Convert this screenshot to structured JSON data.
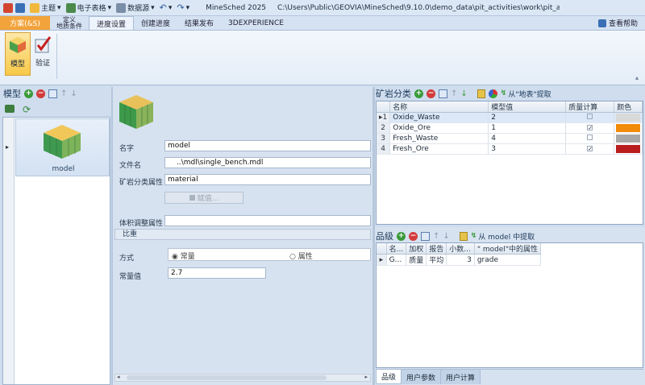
{
  "titlebar": {
    "menu1": "主题",
    "menu2": "电子表格",
    "menu3": "数据源",
    "app_name": "MineSched 2025",
    "path": "C:\\Users\\Public\\GEOVIA\\MineSched\\9.10.0\\demo_data\\pit_activities\\work\\pit_activities...."
  },
  "tabs": {
    "file": "方案(&S)",
    "define_line1": "定义",
    "define_line2": "地质条件",
    "schedule": "进度设置",
    "create": "创建进度",
    "results": "结果发布",
    "experience": "3DEXPERIENCE",
    "help": "查看帮助"
  },
  "ribbon": {
    "model": "模型",
    "verify": "验证"
  },
  "left": {
    "title": "模型",
    "item_label": "model"
  },
  "middle": {
    "name_label": "名字",
    "name_value": "model",
    "file_label": "文件名",
    "file_value": "..\\mdl\\single_bench.mdl",
    "rock_attr_label": "矿岩分类属性",
    "rock_attr_value": "material",
    "assign_button": "赋值...",
    "volume_label": "体积调整属性",
    "volume_value": "",
    "density_group": "比重",
    "method_label": "方式",
    "opt_constant": "常量",
    "opt_attribute": "属性",
    "const_label": "常量值",
    "const_value": "2.7"
  },
  "rock_panel": {
    "title": "矿岩分类",
    "extract": "从\"地表\"提取",
    "columns": [
      "名称",
      "模型值",
      "质量计算",
      "颜色"
    ],
    "rows": [
      {
        "idx": "1",
        "name": "Oxide_Waste",
        "value": "2",
        "quality": false,
        "color": "#d9d9d9"
      },
      {
        "idx": "2",
        "name": "Oxide_Ore",
        "value": "1",
        "quality": true,
        "color": "#f28a0a"
      },
      {
        "idx": "3",
        "name": "Fresh_Waste",
        "value": "4",
        "quality": false,
        "color": "#a8a8a8"
      },
      {
        "idx": "4",
        "name": "Fresh_Ore",
        "value": "3",
        "quality": true,
        "color": "#b91d1d"
      }
    ]
  },
  "grade_panel": {
    "title": "品级",
    "extract": "从 model 中提取",
    "columns": [
      "名...",
      "加权",
      "报告",
      "小数...",
      "\" model\"中的属性"
    ],
    "row": {
      "name": "G...",
      "weight": "质量",
      "report": "平均",
      "decimals": "3",
      "attr": "grade"
    }
  },
  "bottom_tabs": {
    "grade": "品级",
    "user_params": "用户参数",
    "user_calc": "用户计算"
  }
}
